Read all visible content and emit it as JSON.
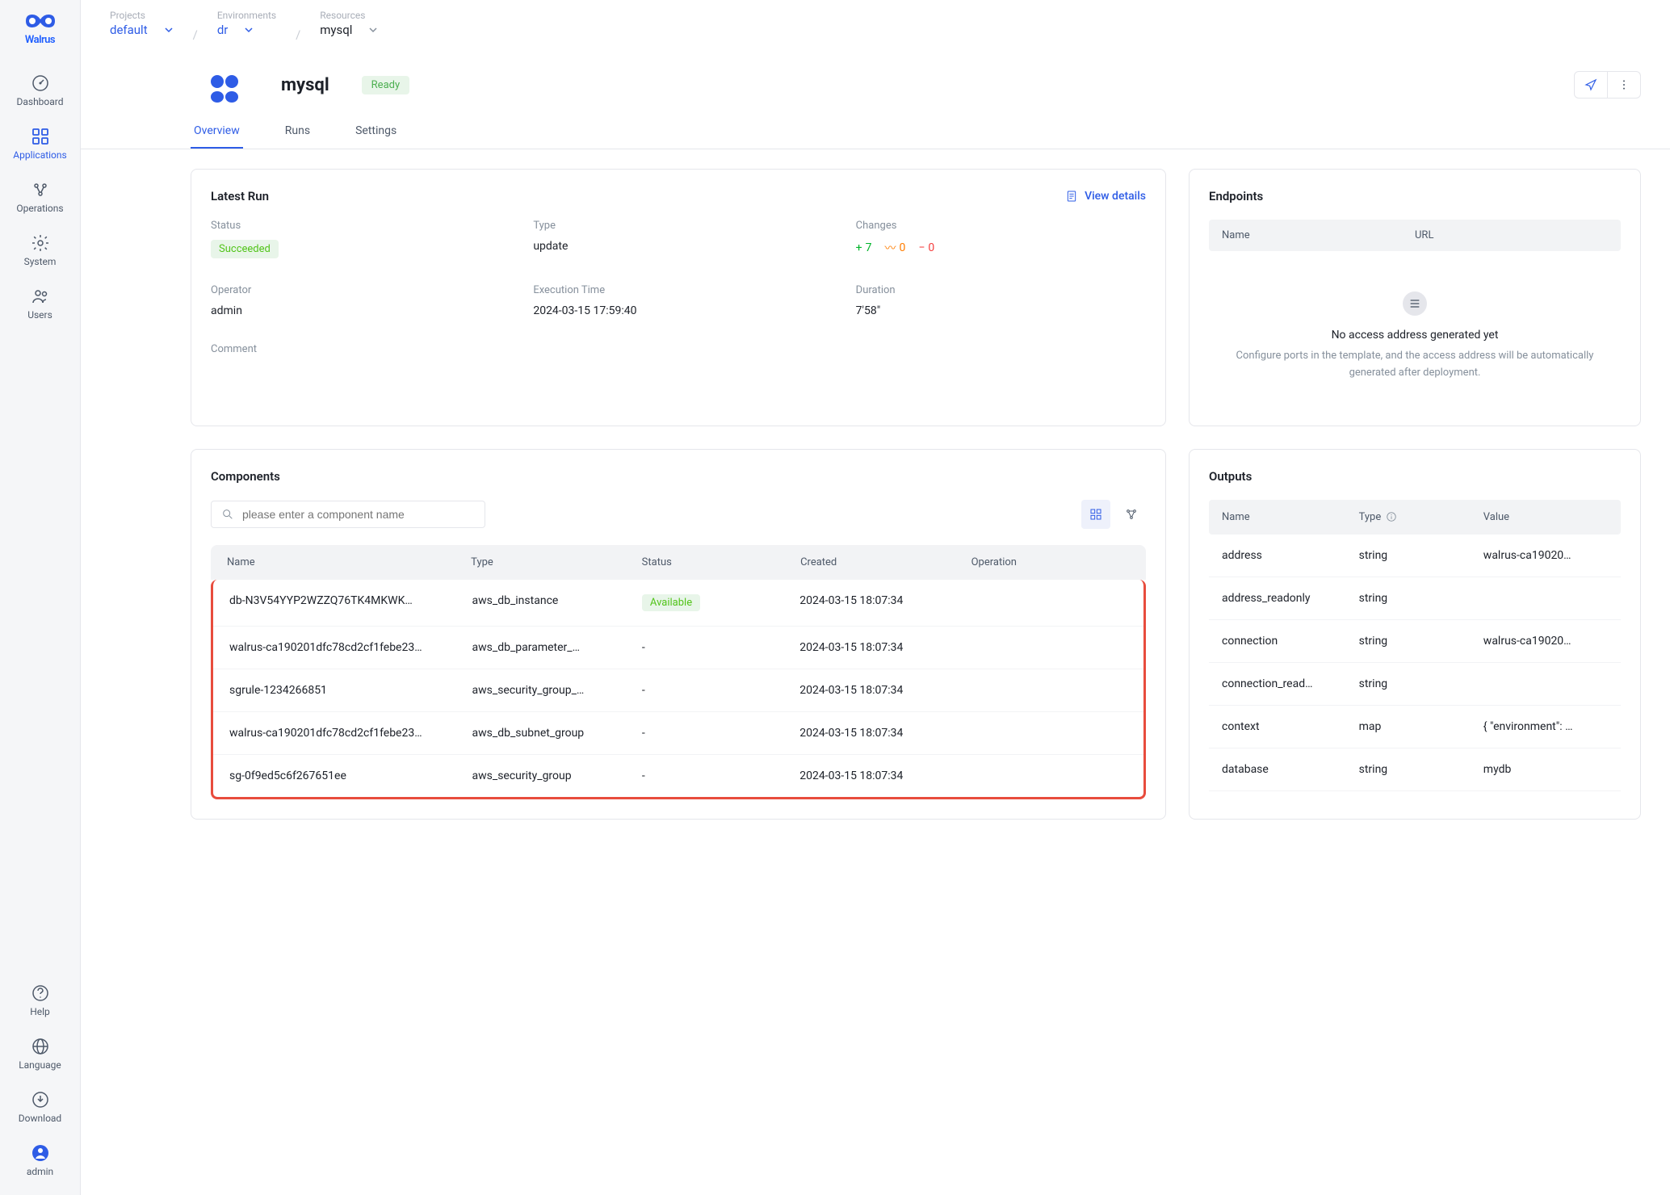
{
  "brand": "Walrus",
  "sidebar": {
    "items": [
      {
        "id": "dashboard",
        "label": "Dashboard"
      },
      {
        "id": "applications",
        "label": "Applications"
      },
      {
        "id": "operations",
        "label": "Operations"
      },
      {
        "id": "system",
        "label": "System"
      },
      {
        "id": "users",
        "label": "Users"
      }
    ],
    "bottom": [
      {
        "id": "help",
        "label": "Help"
      },
      {
        "id": "language",
        "label": "Language"
      },
      {
        "id": "download",
        "label": "Download"
      },
      {
        "id": "admin",
        "label": "admin"
      }
    ]
  },
  "breadcrumb": {
    "projects": {
      "label": "Projects",
      "value": "default"
    },
    "environments": {
      "label": "Environments",
      "value": "dr"
    },
    "resources": {
      "label": "Resources",
      "value": "mysql"
    }
  },
  "page": {
    "title": "mysql",
    "status": "Ready"
  },
  "tabs": [
    "Overview",
    "Runs",
    "Settings"
  ],
  "latest_run": {
    "title": "Latest Run",
    "view_details": "View details",
    "labels": {
      "status": "Status",
      "type": "Type",
      "changes": "Changes",
      "operator": "Operator",
      "execution_time": "Execution Time",
      "duration": "Duration",
      "comment": "Comment"
    },
    "status": "Succeeded",
    "type": "update",
    "changes": {
      "add": 7,
      "modify": 0,
      "delete": 0
    },
    "operator": "admin",
    "execution_time": "2024-03-15 17:59:40",
    "duration": "7'58\""
  },
  "endpoints": {
    "title": "Endpoints",
    "columns": {
      "name": "Name",
      "url": "URL"
    },
    "empty_title": "No access address generated yet",
    "empty_desc": "Configure ports in the template, and the access address will be automatically generated after deployment."
  },
  "components": {
    "title": "Components",
    "search_placeholder": "please enter a component name",
    "columns": {
      "name": "Name",
      "type": "Type",
      "status": "Status",
      "created": "Created",
      "operation": "Operation"
    },
    "rows": [
      {
        "name": "db-N3V54YYP2WZZQ76TK4MKWK…",
        "type": "aws_db_instance",
        "status": "Available",
        "created": "2024-03-15 18:07:34"
      },
      {
        "name": "walrus-ca190201dfc78cd2cf1febe23…",
        "type": "aws_db_parameter_…",
        "status": "-",
        "created": "2024-03-15 18:07:34"
      },
      {
        "name": "sgrule-1234266851",
        "type": "aws_security_group_…",
        "status": "-",
        "created": "2024-03-15 18:07:34"
      },
      {
        "name": "walrus-ca190201dfc78cd2cf1febe23…",
        "type": "aws_db_subnet_group",
        "status": "-",
        "created": "2024-03-15 18:07:34"
      },
      {
        "name": "sg-0f9ed5c6f267651ee",
        "type": "aws_security_group",
        "status": "-",
        "created": "2024-03-15 18:07:34"
      }
    ]
  },
  "outputs": {
    "title": "Outputs",
    "columns": {
      "name": "Name",
      "type": "Type",
      "value": "Value"
    },
    "rows": [
      {
        "name": "address",
        "type": "string",
        "value": "walrus-ca19020…"
      },
      {
        "name": "address_readonly",
        "type": "string",
        "value": ""
      },
      {
        "name": "connection",
        "type": "string",
        "value": "walrus-ca19020…"
      },
      {
        "name": "connection_read…",
        "type": "string",
        "value": ""
      },
      {
        "name": "context",
        "type": "map",
        "value": "{ \"environment\": …"
      },
      {
        "name": "database",
        "type": "string",
        "value": "mydb"
      }
    ]
  }
}
